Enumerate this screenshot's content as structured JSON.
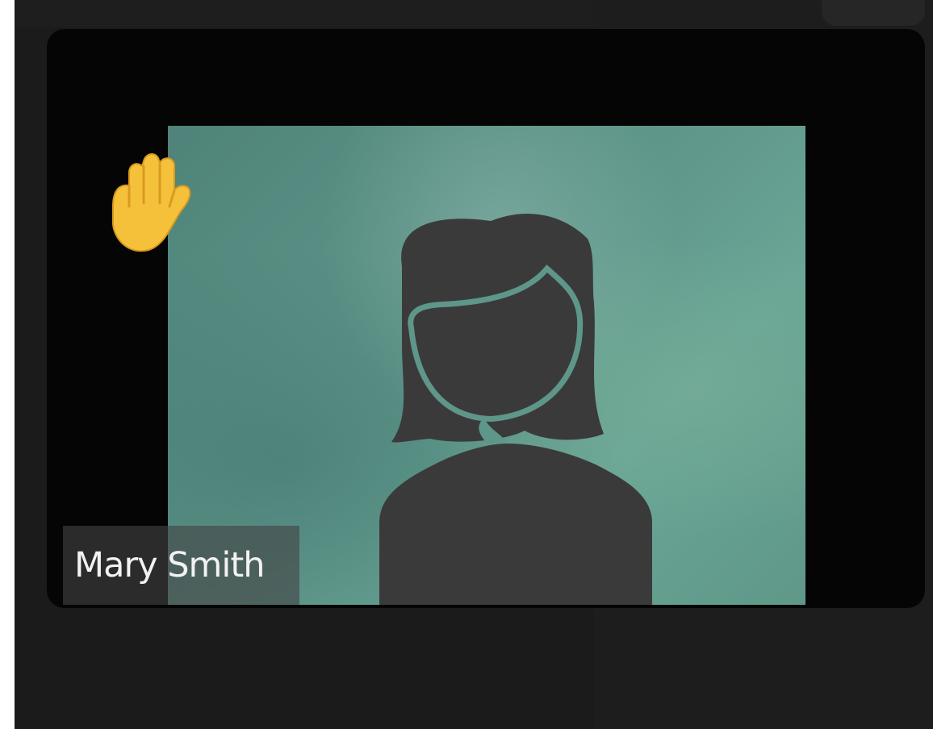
{
  "participant": {
    "name": "Mary Smith",
    "hand_raised": true,
    "status_icon": "raised-hand-icon",
    "avatar_icon": "person-silhouette-icon"
  },
  "colors": {
    "app_background": "#1b1b1b",
    "tile_background": "#050505",
    "video_background": "#5e968a",
    "avatar_fill": "#3b3a3a",
    "hand_fill": "#f5c13b"
  }
}
